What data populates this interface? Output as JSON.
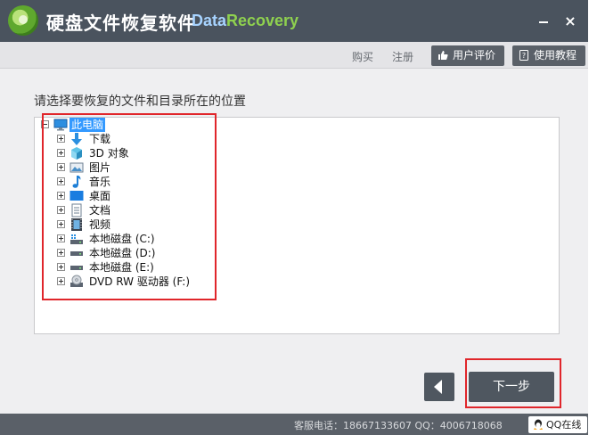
{
  "app": {
    "title": "硬盘文件恢复软件",
    "brand_part1": "Data",
    "brand_part2": "Recovery",
    "minimize_icon": "minimize-icon",
    "close_label": "×"
  },
  "toolbar": {
    "buy_label": "购买",
    "register_label": "注册",
    "rating_label": "用户评价",
    "tutorial_label": "使用教程"
  },
  "main": {
    "instruction": "请选择要恢复的文件和目录所在的位置",
    "tree": {
      "root": {
        "label": "此电脑",
        "icon": "computer-icon",
        "selected": true
      },
      "items": [
        {
          "label": "下载",
          "icon": "download-arrow-icon"
        },
        {
          "label": "3D 对象",
          "icon": "3d-cube-icon"
        },
        {
          "label": "图片",
          "icon": "pictures-icon"
        },
        {
          "label": "音乐",
          "icon": "music-note-icon"
        },
        {
          "label": "桌面",
          "icon": "desktop-icon"
        },
        {
          "label": "文档",
          "icon": "document-icon"
        },
        {
          "label": "视频",
          "icon": "video-film-icon"
        },
        {
          "label": "本地磁盘 (C:)",
          "icon": "system-drive-icon"
        },
        {
          "label": "本地磁盘 (D:)",
          "icon": "drive-icon"
        },
        {
          "label": "本地磁盘 (E:)",
          "icon": "drive-icon"
        },
        {
          "label": "DVD RW 驱动器 (F:)",
          "icon": "dvd-drive-icon"
        }
      ]
    }
  },
  "nav": {
    "back_icon": "back-arrow-icon",
    "next_label": "下一步"
  },
  "status": {
    "hotline": "客服电话：18667133607 QQ：4006718068",
    "qq_online": "QQ在线"
  },
  "colors": {
    "titlebar": "#4a535e",
    "highlight_red": "#e0262b",
    "selection_blue": "#3399ff",
    "brand_data": "#a7d3ff",
    "brand_recovery": "#8fd14f"
  }
}
